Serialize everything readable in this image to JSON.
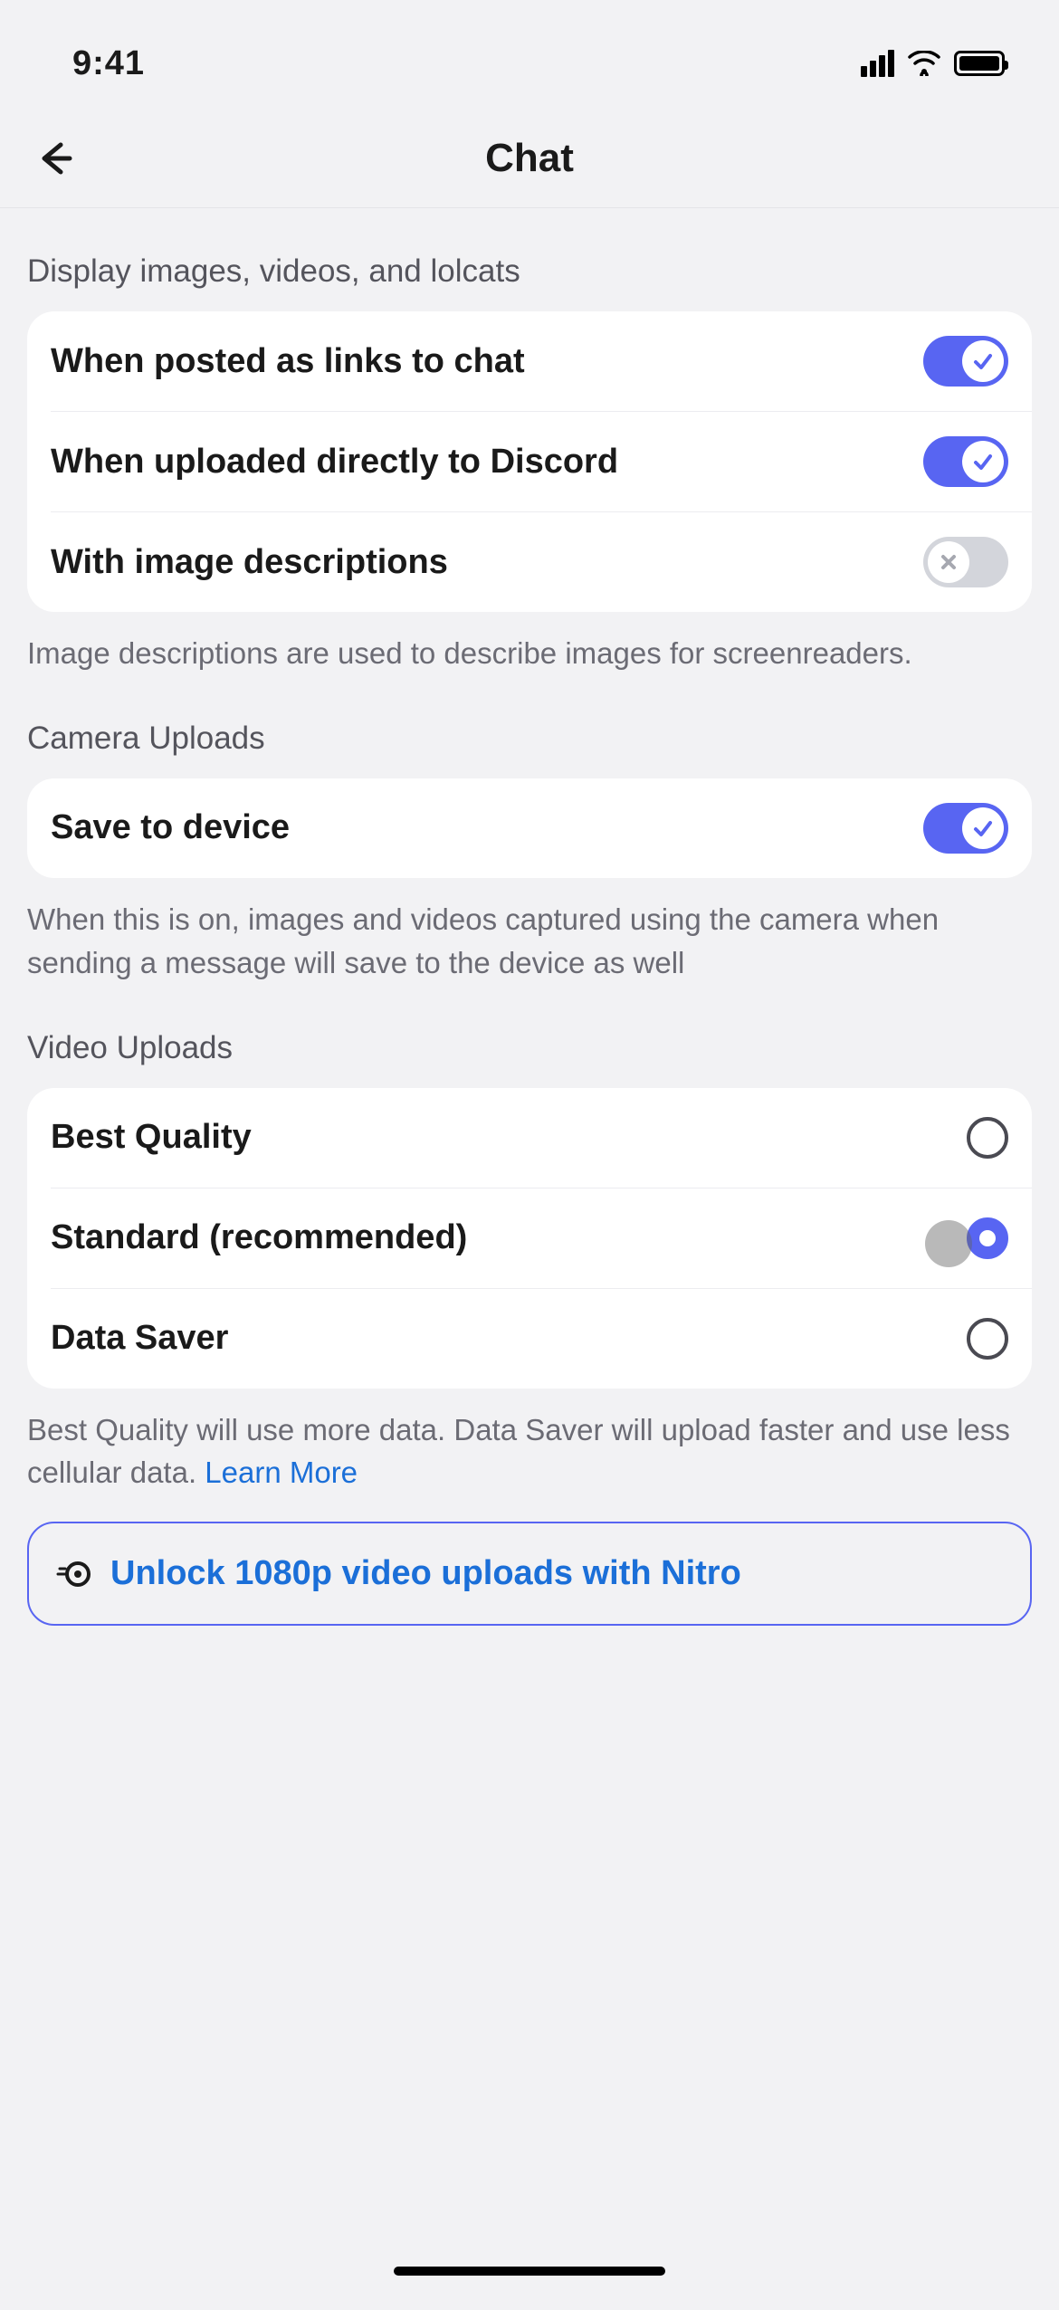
{
  "status": {
    "time": "9:41"
  },
  "header": {
    "title": "Chat"
  },
  "sections": {
    "display": {
      "header": "Display images, videos, and lolcats",
      "items": {
        "links": {
          "label": "When posted as links to chat",
          "on": true
        },
        "uploaded": {
          "label": "When uploaded directly to Discord",
          "on": true
        },
        "descriptions": {
          "label": "With image descriptions",
          "on": false
        }
      },
      "footer": "Image descriptions are used to describe images for screenreaders."
    },
    "camera": {
      "header": "Camera Uploads",
      "items": {
        "save": {
          "label": "Save to device",
          "on": true
        }
      },
      "footer": "When this is on, images and videos captured using the camera when sending a message will save to the device as well"
    },
    "video": {
      "header": "Video Uploads",
      "options": {
        "best": {
          "label": "Best Quality",
          "selected": false
        },
        "standard": {
          "label": "Standard (recommended)",
          "selected": true
        },
        "datasaver": {
          "label": "Data Saver",
          "selected": false
        }
      },
      "footer_prefix": "Best Quality will use more data. Data Saver will upload faster and use less cellular data. ",
      "footer_link": "Learn More"
    },
    "nitro": {
      "text": "Unlock 1080p video uploads with Nitro"
    }
  }
}
